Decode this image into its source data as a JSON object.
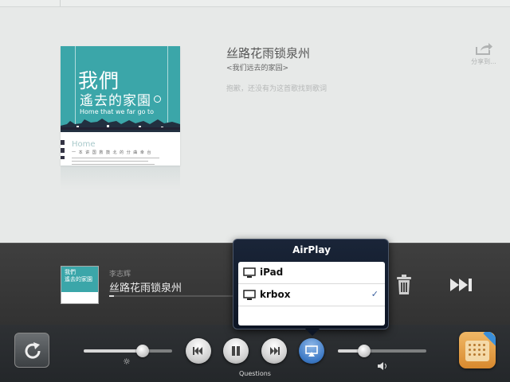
{
  "song": {
    "title": "丝路花雨锁泉州",
    "album": "<我们远去的家园>",
    "no_lyrics_message": "抱歉，还没有为这首歌找到歌词",
    "share_label": "分享到..."
  },
  "album_art": {
    "title_line1": "我們",
    "title_line2": "遙去的家園",
    "subtitle_en": "Home that we far go to",
    "home_word": "Home",
    "tagline": "一 本 讲 国 救 鼓 北 的 分 曲 幸 台"
  },
  "now_playing": {
    "artist": "李志辉",
    "title": "丝路花雨锁泉州",
    "thumb_text": "我們\n遙去的家園",
    "progress": 0.04
  },
  "controls": {
    "brightness_level": 0.67,
    "volume_level": 0.3,
    "airplay_label": "Questions"
  },
  "airplay": {
    "title": "AirPlay",
    "devices": [
      {
        "name": "iPad",
        "selected": false
      },
      {
        "name": "krbox",
        "selected": true
      }
    ],
    "check_mark": "✓"
  },
  "colors": {
    "accent_teal": "#3ba6a9",
    "airplay_blue": "#3b78c4",
    "app_orange": "#e0a048"
  }
}
